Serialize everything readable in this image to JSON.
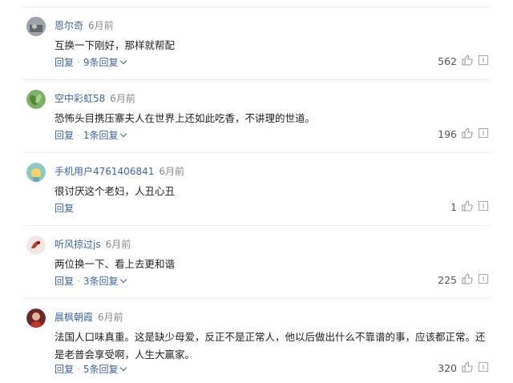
{
  "comments": [
    {
      "user": "恩尔奇",
      "time": "6月前",
      "text": "互换一下刚好，那样就帮配",
      "reply_label": "回复",
      "replies_label": "9条回复",
      "likes": "562"
    },
    {
      "user": "空中彩虹58",
      "time": "6月前",
      "text": "恐怖头目携压寨夫人在世界上还如此吃香，不讲理的世道。",
      "reply_label": "回复",
      "replies_label": "1条回复",
      "likes": "196"
    },
    {
      "user": "手机用户4761406841",
      "time": "6月前",
      "text": "很讨厌这个老妇，人丑心丑",
      "reply_label": "回复",
      "replies_label": "",
      "likes": "1"
    },
    {
      "user": "听风掠过js",
      "time": "6月前",
      "text": "两位换一下、看上去更和谐",
      "reply_label": "回复",
      "replies_label": "3条回复",
      "likes": "225"
    },
    {
      "user": "晨枫朝霞",
      "time": "6月前",
      "text": "法国人口味真重。这是缺少母爱，反正不是正常人，他以后做出什么不靠谱的事，应该都正常。还是老普会享受啊，人生大赢家。",
      "reply_label": "回复",
      "replies_label": "5条回复",
      "likes": "320"
    }
  ],
  "colors": {
    "link": "#406599",
    "meta": "#888888",
    "divider": "#ececec"
  },
  "icons": [
    "thumb-up-icon",
    "more-icon",
    "chevron-down-icon"
  ]
}
